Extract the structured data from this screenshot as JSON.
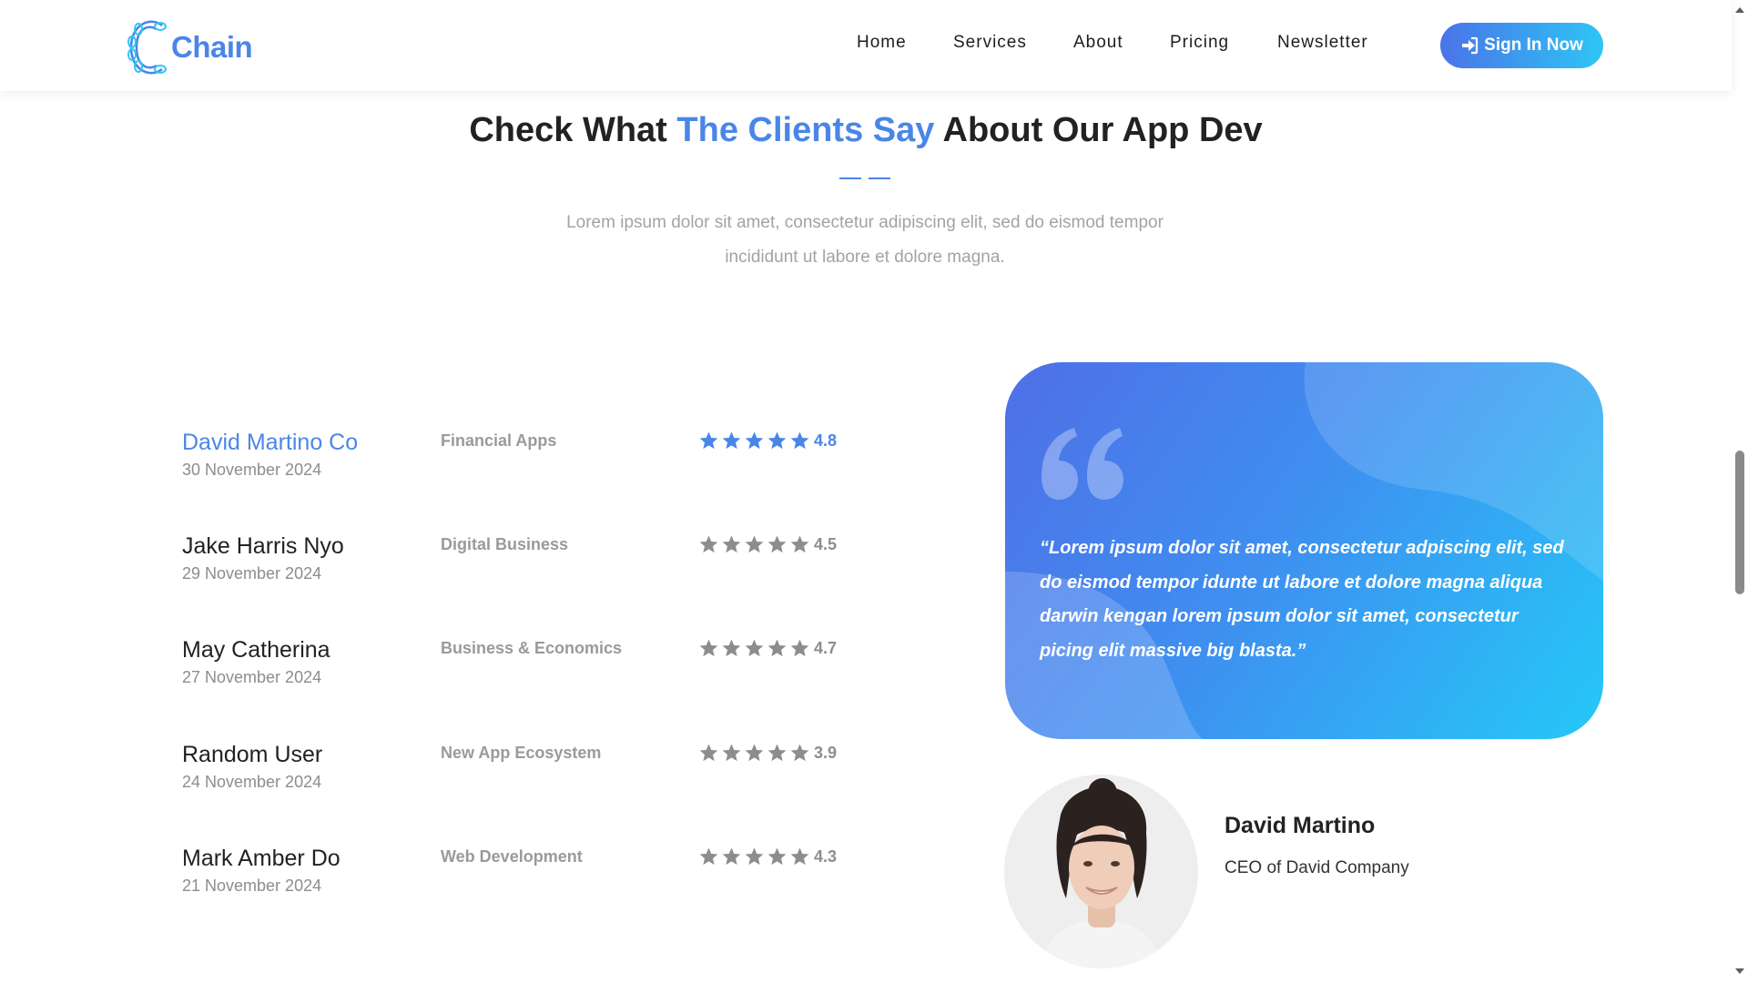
{
  "brand": {
    "name": "Chain"
  },
  "nav": {
    "items": [
      {
        "label": "Home"
      },
      {
        "label": "Services"
      },
      {
        "label": "About"
      },
      {
        "label": "Pricing"
      },
      {
        "label": "Newsletter"
      }
    ],
    "cta_label": "Sign In Now",
    "cta_icon": "sign-in-icon"
  },
  "section": {
    "title_pre": "Check What ",
    "title_accent": "The Clients Say",
    "title_post": " About Our App Dev",
    "subtitle": "Lorem ipsum dolor sit amet, consectetur adipiscing elit, sed do eismod tempor incididunt ut labore et dolore magna."
  },
  "reviews": [
    {
      "name": "David Martino Co",
      "date": "30 November 2024",
      "category": "Financial Apps",
      "rating": "4.8",
      "stars": 5,
      "active": true
    },
    {
      "name": "Jake Harris Nyo",
      "date": "29 November 2024",
      "category": "Digital Business",
      "rating": "4.5",
      "stars": 5,
      "active": false
    },
    {
      "name": "May Catherina",
      "date": "27 November 2024",
      "category": "Business & Economics",
      "rating": "4.7",
      "stars": 5,
      "active": false
    },
    {
      "name": "Random User",
      "date": "24 November 2024",
      "category": "New App Ecosystem",
      "rating": "3.9",
      "stars": 5,
      "active": false
    },
    {
      "name": "Mark Amber Do",
      "date": "21 November 2024",
      "category": "Web Development",
      "rating": "4.3",
      "stars": 5,
      "active": false
    }
  ],
  "testimonial": {
    "quote": "“Lorem ipsum dolor sit amet, consectetur adpiscing elit, sed do eismod tempor idunte ut labore et dolore magna aliqua darwin kengan lorem ipsum dolor sit amet, consectetur picing elit massive big blasta.”",
    "author": "David Martino",
    "role": "CEO of David Company"
  },
  "colors": {
    "accent": "#4a86e8",
    "star_active": "#4a86e8",
    "star_inactive": "#8d8d8d",
    "card_gradient_start": "#4f6fe6",
    "card_gradient_end": "#25c8f7"
  },
  "icons": {
    "logo": "chain-link-icon",
    "quote": "quote-icon",
    "star": "star-icon"
  }
}
